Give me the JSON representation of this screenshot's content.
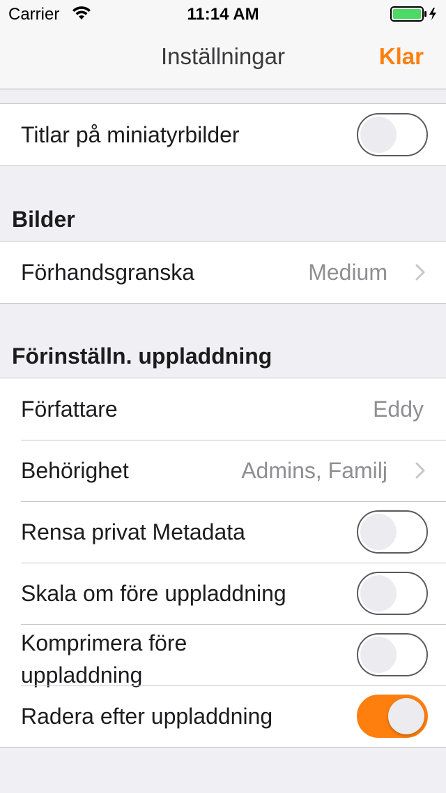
{
  "status_bar": {
    "carrier": "Carrier",
    "time": "11:14 AM",
    "battery_color": "#4cd964"
  },
  "nav": {
    "title": "Inställningar",
    "done_label": "Klar",
    "accent_color": "#ff7f0e"
  },
  "group_top": {
    "rows": [
      {
        "label": "Titlar på miniatyrbilder",
        "toggle": false
      }
    ]
  },
  "section_bilder": {
    "header": "Bilder",
    "rows": [
      {
        "label": "Förhandsgranska",
        "value": "Medium"
      }
    ]
  },
  "section_upload": {
    "header": "Förinställn. uppladdning",
    "rows": [
      {
        "label": "Författare",
        "value": "Eddy"
      },
      {
        "label": "Behörighet",
        "value": "Admins, Familj"
      },
      {
        "label": "Rensa privat Metadata",
        "toggle": false
      },
      {
        "label": "Skala om före uppladdning",
        "toggle": false
      },
      {
        "label": "Komprimera före uppladdning",
        "toggle": false
      },
      {
        "label": "Radera efter uppladdning",
        "toggle": true
      }
    ]
  }
}
